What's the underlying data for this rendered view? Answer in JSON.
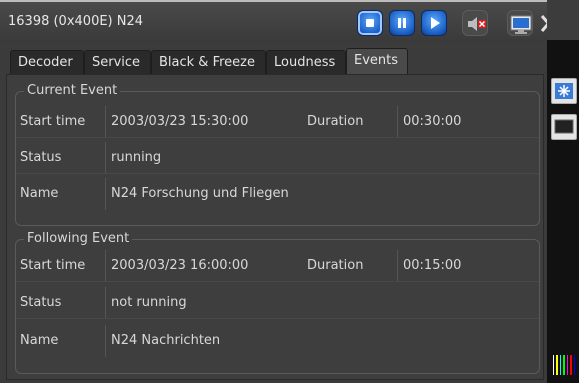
{
  "window": {
    "title": "16398 (0x400E) N24"
  },
  "toolbar": {
    "buttons": [
      {
        "name": "stop-button",
        "icon": "stop-icon"
      },
      {
        "name": "pause-button",
        "icon": "pause-icon"
      },
      {
        "name": "play-button",
        "icon": "play-icon"
      },
      {
        "name": "mute-button",
        "icon": "speaker-muted-icon"
      },
      {
        "name": "monitor-button",
        "icon": "monitor-icon"
      },
      {
        "name": "tools-button",
        "icon": "wrench-icon"
      }
    ]
  },
  "tabs": [
    {
      "label": "Decoder",
      "active": false
    },
    {
      "label": "Service",
      "active": false
    },
    {
      "label": "Black & Freeze",
      "active": false
    },
    {
      "label": "Loudness",
      "active": false
    },
    {
      "label": "Events",
      "active": true
    }
  ],
  "current_event": {
    "title": "Current Event",
    "start_time_label": "Start time",
    "start_time": "2003/03/23 15:30:00",
    "duration_label": "Duration",
    "duration": "00:30:00",
    "status_label": "Status",
    "status": "running",
    "name_label": "Name",
    "name": "N24 Forschung und Fliegen"
  },
  "following_event": {
    "title": "Following Event",
    "start_time_label": "Start time",
    "start_time": "2003/03/23 16:00:00",
    "duration_label": "Duration",
    "duration": "00:15:00",
    "status_label": "Status",
    "status": "not running",
    "name_label": "Name",
    "name": "N24 Nachrichten"
  },
  "colors": {
    "accent_blue": "#1b5fc4",
    "panel_bg": "#3e3e3e",
    "text": "#d8d8d8"
  }
}
